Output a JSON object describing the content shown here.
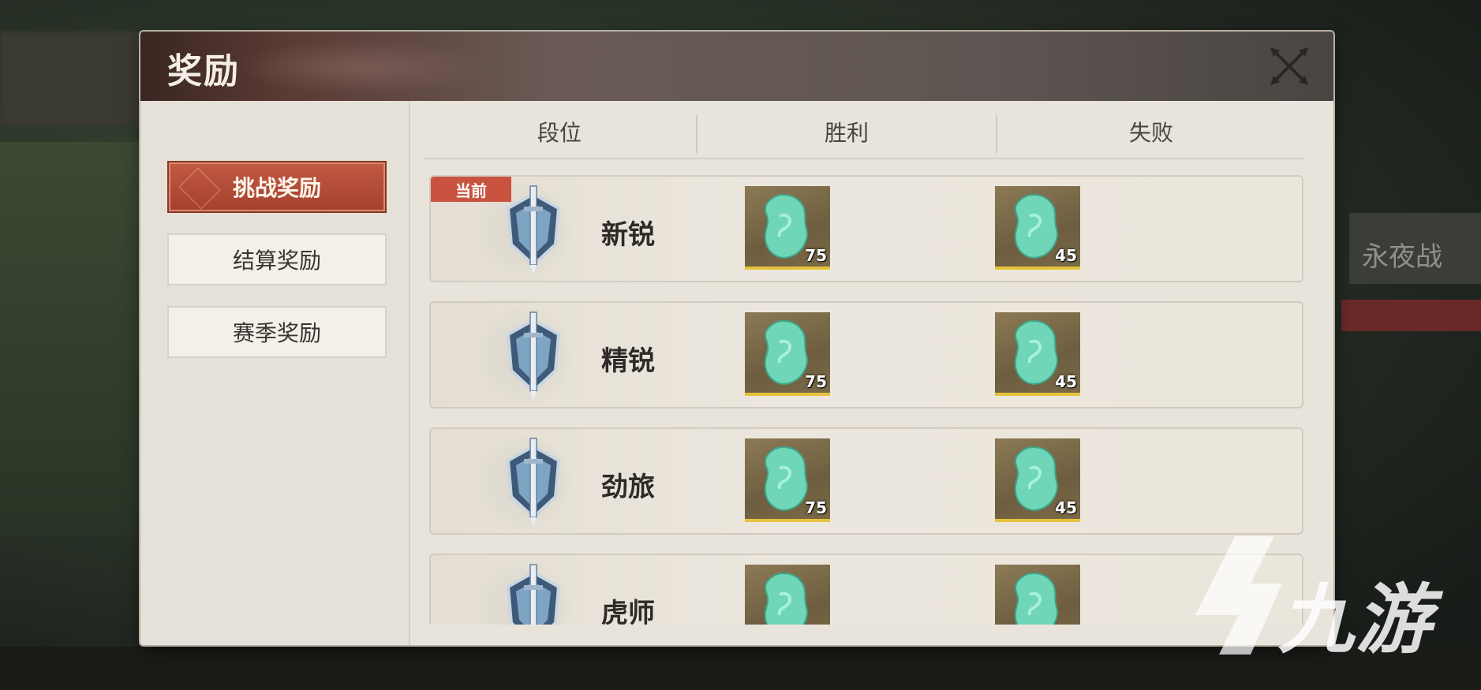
{
  "window": {
    "title": "奖励",
    "close_icon": "close-crossed-swords-icon"
  },
  "sidebar": {
    "items": [
      {
        "label": "挑战奖励",
        "active": true
      },
      {
        "label": "结算奖励",
        "active": false
      },
      {
        "label": "赛季奖励",
        "active": false
      }
    ]
  },
  "table": {
    "headers": [
      "段位",
      "胜利",
      "失败"
    ],
    "current_tag": "当前",
    "rows": [
      {
        "rank": "新锐",
        "win_qty": "75",
        "lose_qty": "45",
        "current": true,
        "emblem_icon": "rank-shield-sword-icon",
        "reward_icon": "jade-token-icon"
      },
      {
        "rank": "精锐",
        "win_qty": "75",
        "lose_qty": "45",
        "current": false,
        "emblem_icon": "rank-shield-sword-icon",
        "reward_icon": "jade-token-icon"
      },
      {
        "rank": "劲旅",
        "win_qty": "75",
        "lose_qty": "45",
        "current": false,
        "emblem_icon": "rank-shield-sword-icon",
        "reward_icon": "jade-token-icon"
      },
      {
        "rank": "虎师",
        "win_qty": "",
        "lose_qty": "",
        "current": false,
        "emblem_icon": "rank-shield-sword-icon",
        "reward_icon": "jade-token-icon"
      }
    ]
  },
  "colors": {
    "accent_red": "#c85440",
    "panel_bg": "#e9e4db",
    "qty_bar": "#e6c23a",
    "jade": "#6fd6b8"
  },
  "watermark": {
    "text": "九游",
    "logo_icon": "9game-logo-icon"
  },
  "background": {
    "partial_text": "永夜战"
  }
}
